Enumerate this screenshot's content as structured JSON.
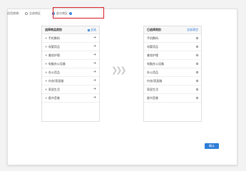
{
  "scope": {
    "label": "适用商铺：",
    "options": [
      {
        "label": "全部商区",
        "checked": false
      },
      {
        "label": "部分商区",
        "checked": true
      }
    ],
    "info_glyph": "?"
  },
  "left_panel": {
    "title": "选择商品类别",
    "header_action": "全选",
    "items": [
      {
        "label": "手机数码"
      },
      {
        "label": "母婴用品"
      },
      {
        "label": "美妆护理"
      },
      {
        "label": "电脑办公设备"
      },
      {
        "label": "办公用品"
      },
      {
        "label": "内衣/家居服"
      },
      {
        "label": "家居生活"
      },
      {
        "label": "图书音像"
      }
    ],
    "item_prefix": "+",
    "arrow_glyph": "➜"
  },
  "right_panel": {
    "title": "已选择类别",
    "header_action": "全部清空",
    "items": [
      {
        "label": "手机数码"
      },
      {
        "label": "母婴用品"
      },
      {
        "label": "美妆护理"
      },
      {
        "label": "电脑办公设备"
      },
      {
        "label": "办公用品"
      },
      {
        "label": "内衣/家居服"
      },
      {
        "label": "家居生活"
      },
      {
        "label": "图书音像"
      }
    ]
  },
  "transfer_glyph": "❯❯❯",
  "confirm_label": "确认",
  "colors": {
    "accent": "#2f7ed8",
    "highlight_border": "#d9232e"
  }
}
